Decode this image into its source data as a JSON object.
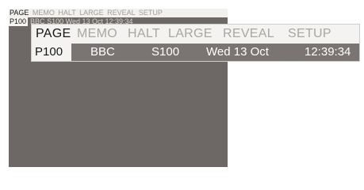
{
  "menu": {
    "items": [
      "PAGE",
      "MEMO",
      "HALT",
      "LARGE",
      "REVEAL",
      "SETUP"
    ],
    "active_index": 0
  },
  "info_bar": {
    "page_number": "P100",
    "channel": "BBC",
    "subpage": "S100",
    "date": "Wed 13 Oct",
    "time": "12:39:34"
  },
  "colors": {
    "screen_bg": "#6d6865",
    "menu_bg": "#f4f3f1",
    "menu_active_text": "#161616",
    "menu_inactive_text": "#aaa6a2",
    "info_text": "#ffffff"
  }
}
